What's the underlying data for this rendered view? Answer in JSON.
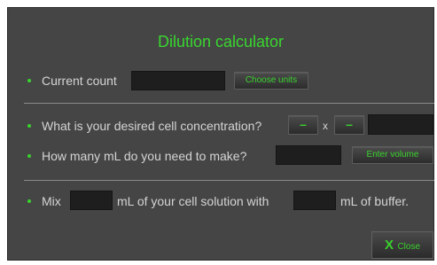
{
  "dialog": {
    "title": "Dilution calculator"
  },
  "current_count": {
    "label": "Current count",
    "value": "",
    "choose_units_label": "Choose units"
  },
  "concentration": {
    "label": "What is your desired cell concentration?",
    "mantissa_value": "–",
    "multiplier": "x",
    "exponent_value": "–",
    "result_value": ""
  },
  "volume": {
    "label": "How many mL do you need to make?",
    "value": "",
    "enter_volume_label": "Enter volume"
  },
  "mix": {
    "prefix": "Mix",
    "cell_solution_value": "",
    "middle": "mL of your cell solution with",
    "buffer_value": "",
    "suffix": "mL of buffer."
  },
  "close": {
    "x_label": "X",
    "label": "Close"
  },
  "colors": {
    "accent": "#39d62f",
    "panel": "#454545",
    "field": "#1e1e1e",
    "text": "#d4d4d4"
  }
}
